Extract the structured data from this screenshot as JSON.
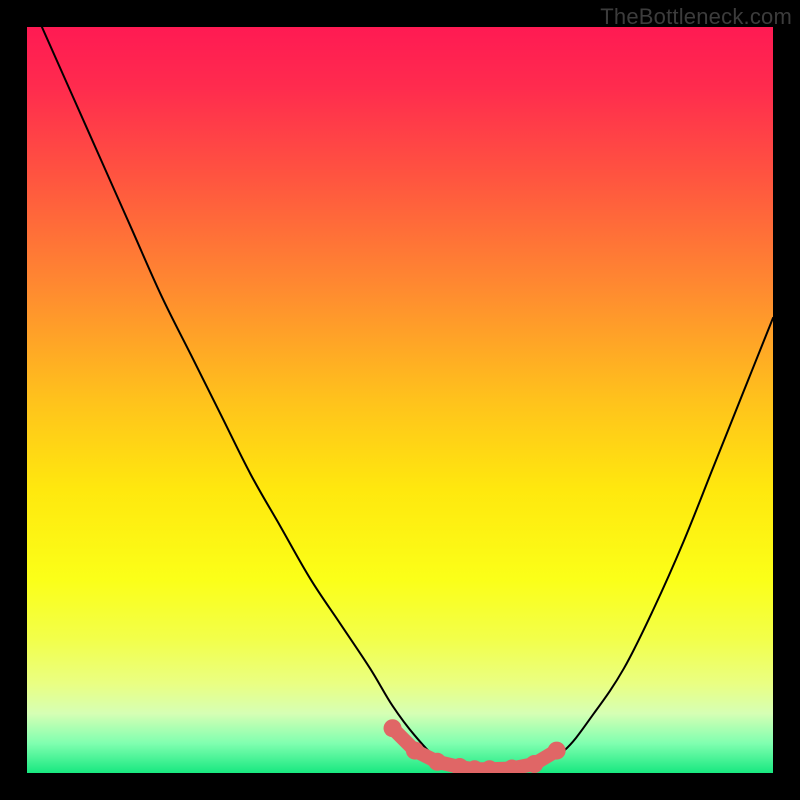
{
  "watermark": "TheBottleneck.com",
  "colors": {
    "black": "#000000",
    "curve": "#000000",
    "marker": "#e06666",
    "gradient_stops": [
      {
        "offset": 0.0,
        "color": "#ff1a53"
      },
      {
        "offset": 0.08,
        "color": "#ff2b4e"
      },
      {
        "offset": 0.2,
        "color": "#ff5440"
      },
      {
        "offset": 0.35,
        "color": "#ff8a30"
      },
      {
        "offset": 0.5,
        "color": "#ffc21c"
      },
      {
        "offset": 0.62,
        "color": "#ffe80e"
      },
      {
        "offset": 0.74,
        "color": "#fbff18"
      },
      {
        "offset": 0.82,
        "color": "#f2ff4a"
      },
      {
        "offset": 0.88,
        "color": "#eaff82"
      },
      {
        "offset": 0.92,
        "color": "#d6ffb4"
      },
      {
        "offset": 0.96,
        "color": "#80ffb0"
      },
      {
        "offset": 1.0,
        "color": "#18e880"
      }
    ]
  },
  "chart_data": {
    "type": "line",
    "title": "",
    "xlabel": "",
    "ylabel": "",
    "xlim": [
      0,
      100
    ],
    "ylim": [
      0,
      100
    ],
    "series": [
      {
        "name": "bottleneck_curve",
        "x": [
          2,
          6,
          10,
          14,
          18,
          22,
          26,
          30,
          34,
          38,
          42,
          46,
          49,
          52,
          55,
          58,
          60,
          62,
          65,
          68,
          72,
          76,
          80,
          84,
          88,
          92,
          96,
          100
        ],
        "y": [
          100,
          91,
          82,
          73,
          64,
          56,
          48,
          40,
          33,
          26,
          20,
          14,
          9,
          5,
          2,
          1,
          0,
          0,
          0,
          1,
          3,
          8,
          14,
          22,
          31,
          41,
          51,
          61
        ]
      }
    ],
    "markers": {
      "name": "highlighted_range",
      "x": [
        49,
        52,
        55,
        58,
        60,
        62,
        65,
        68,
        71
      ],
      "y": [
        6,
        3,
        1.5,
        0.8,
        0.5,
        0.5,
        0.6,
        1.2,
        3
      ]
    }
  }
}
